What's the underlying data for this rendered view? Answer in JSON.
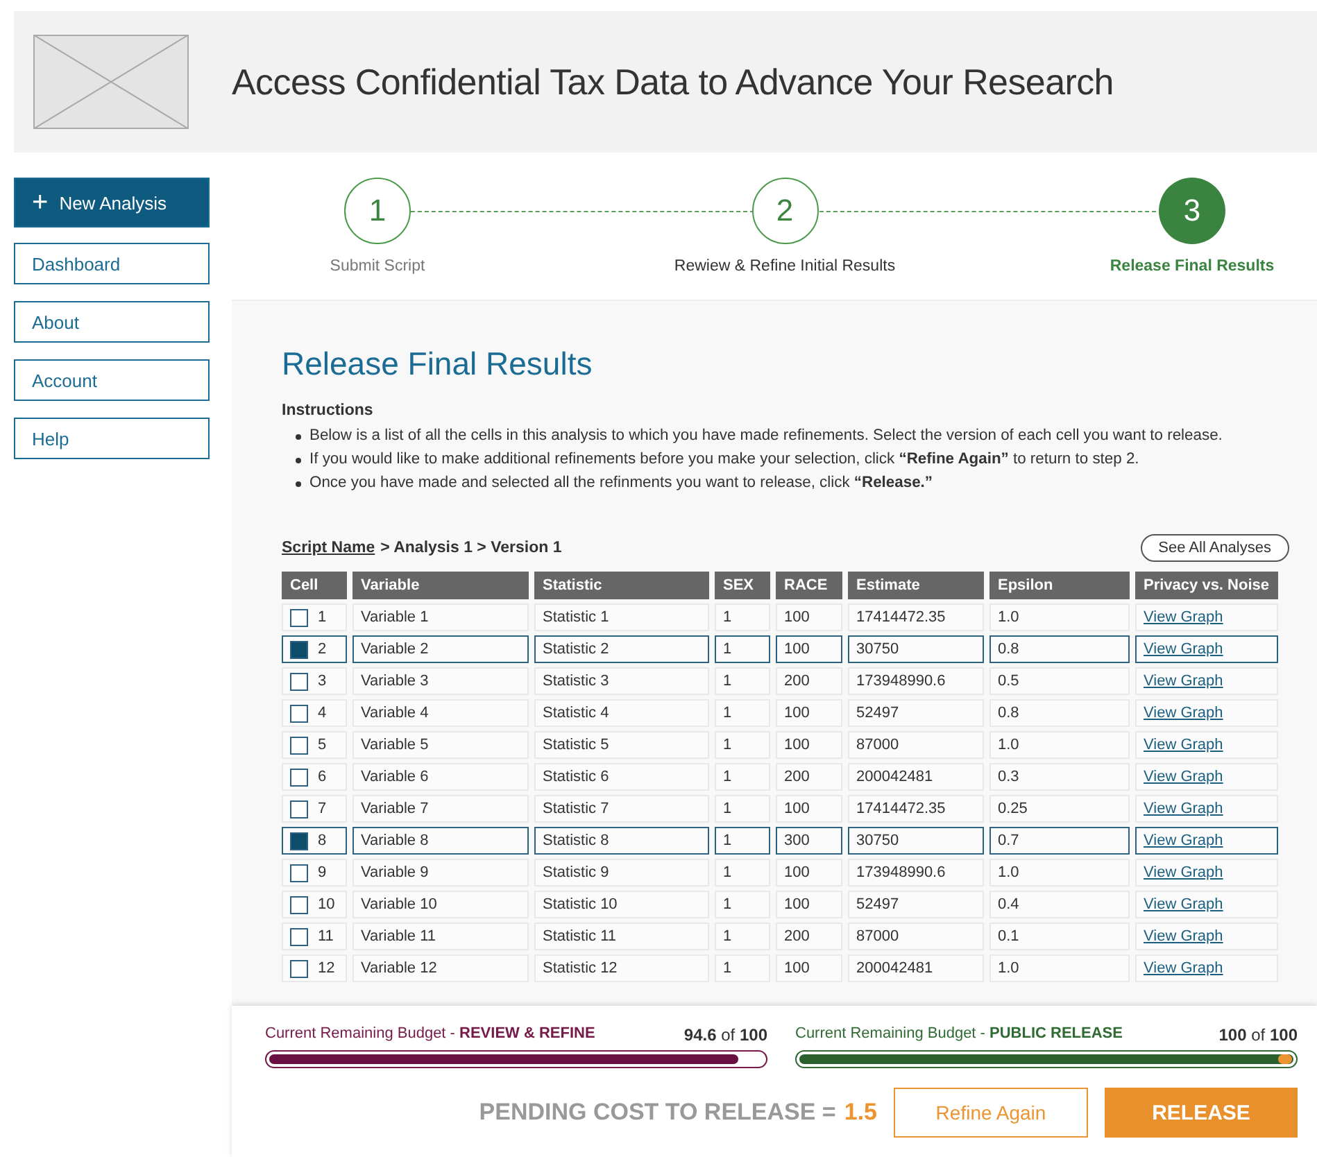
{
  "header": {
    "title": "Access Confidential Tax Data to Advance Your Research"
  },
  "sidebar": {
    "items": [
      {
        "label": "New Analysis",
        "kind": "primary",
        "icon": "+"
      },
      {
        "label": "Dashboard",
        "kind": "link"
      },
      {
        "label": "About",
        "kind": "link"
      },
      {
        "label": "Account",
        "kind": "link"
      },
      {
        "label": "Help",
        "kind": "link"
      }
    ]
  },
  "steps": [
    {
      "number": "1",
      "label": "Submit Script",
      "selected": false,
      "dimmed": true
    },
    {
      "number": "2",
      "label": "Rewiew & Refine Initial Results",
      "selected": false,
      "dimmed": false
    },
    {
      "number": "3",
      "label": "Release Final Results",
      "selected": true,
      "dimmed": false
    }
  ],
  "content": {
    "heading": "Release Final Results",
    "instructions_title": "Instructions",
    "instructions": [
      "Below is a list of all the cells in this analysis to which you have made refinements. Select the version of each cell you want to release.",
      "If you would like to make additional refinements before you make your selection, click **“Refine Again”** to return to step 2.",
      "Once you have made and selected all the refinments you want to release, click **“Release.”**"
    ],
    "breadcrumb": {
      "link": "Script Name",
      "rest": "> Analysis 1 > Version 1"
    },
    "see_all": "See All Analyses"
  },
  "table": {
    "columns": [
      "Cell",
      "Variable",
      "Statistic",
      "SEX",
      "RACE",
      "Estimate",
      "Epsilon",
      "Privacy vs. Noise"
    ],
    "rows": [
      {
        "cell": "1",
        "variable": "Variable 1",
        "statistic": "Statistic 1",
        "sex": "1",
        "race": "100",
        "estimate": "17414472.35",
        "epsilon": "1.0",
        "link": "View Graph",
        "selected": false
      },
      {
        "cell": "2",
        "variable": "Variable 2",
        "statistic": "Statistic 2",
        "sex": "1",
        "race": "100",
        "estimate": "30750",
        "epsilon": "0.8",
        "link": "View Graph",
        "selected": true
      },
      {
        "cell": "3",
        "variable": "Variable 3",
        "statistic": "Statistic 3",
        "sex": "1",
        "race": "200",
        "estimate": "173948990.6",
        "epsilon": "0.5",
        "link": "View Graph",
        "selected": false
      },
      {
        "cell": "4",
        "variable": "Variable 4",
        "statistic": "Statistic 4",
        "sex": "1",
        "race": "100",
        "estimate": "52497",
        "epsilon": "0.8",
        "link": "View Graph",
        "selected": false
      },
      {
        "cell": "5",
        "variable": "Variable 5",
        "statistic": "Statistic 5",
        "sex": "1",
        "race": "100",
        "estimate": "87000",
        "epsilon": "1.0",
        "link": "View Graph",
        "selected": false
      },
      {
        "cell": "6",
        "variable": "Variable 6",
        "statistic": "Statistic 6",
        "sex": "1",
        "race": "200",
        "estimate": "200042481",
        "epsilon": "0.3",
        "link": "View Graph",
        "selected": false
      },
      {
        "cell": "7",
        "variable": "Variable 7",
        "statistic": "Statistic 7",
        "sex": "1",
        "race": "100",
        "estimate": "17414472.35",
        "epsilon": "0.25",
        "link": "View Graph",
        "selected": false
      },
      {
        "cell": "8",
        "variable": "Variable 8",
        "statistic": "Statistic 8",
        "sex": "1",
        "race": "300",
        "estimate": "30750",
        "epsilon": "0.7",
        "link": "View Graph",
        "selected": true
      },
      {
        "cell": "9",
        "variable": "Variable 9",
        "statistic": "Statistic 9",
        "sex": "1",
        "race": "100",
        "estimate": "173948990.6",
        "epsilon": "1.0",
        "link": "View Graph",
        "selected": false
      },
      {
        "cell": "10",
        "variable": "Variable 10",
        "statistic": "Statistic 10",
        "sex": "1",
        "race": "100",
        "estimate": "52497",
        "epsilon": "0.4",
        "link": "View Graph",
        "selected": false
      },
      {
        "cell": "11",
        "variable": "Variable 11",
        "statistic": "Statistic 11",
        "sex": "1",
        "race": "200",
        "estimate": "87000",
        "epsilon": "0.1",
        "link": "View Graph",
        "selected": false
      },
      {
        "cell": "12",
        "variable": "Variable 12",
        "statistic": "Statistic 12",
        "sex": "1",
        "race": "100",
        "estimate": "200042481",
        "epsilon": "1.0",
        "link": "View Graph",
        "selected": false
      }
    ]
  },
  "budgets": [
    {
      "label": "Current Remaining Budget - **REVIEW & REFINE**",
      "value": "**94.6** of **100**",
      "kind": "refine",
      "level": 0.95
    },
    {
      "label": "Current Remaining Budget - **PUBLIC RELEASE**",
      "value": "**100** of **100**",
      "kind": "release",
      "level": 1.0
    }
  ],
  "footer": {
    "pending_label": "PENDING COST TO RELEASE =",
    "pending_value": "1.5",
    "refine_button": "Refine Again",
    "release_button": "RELEASE"
  }
}
